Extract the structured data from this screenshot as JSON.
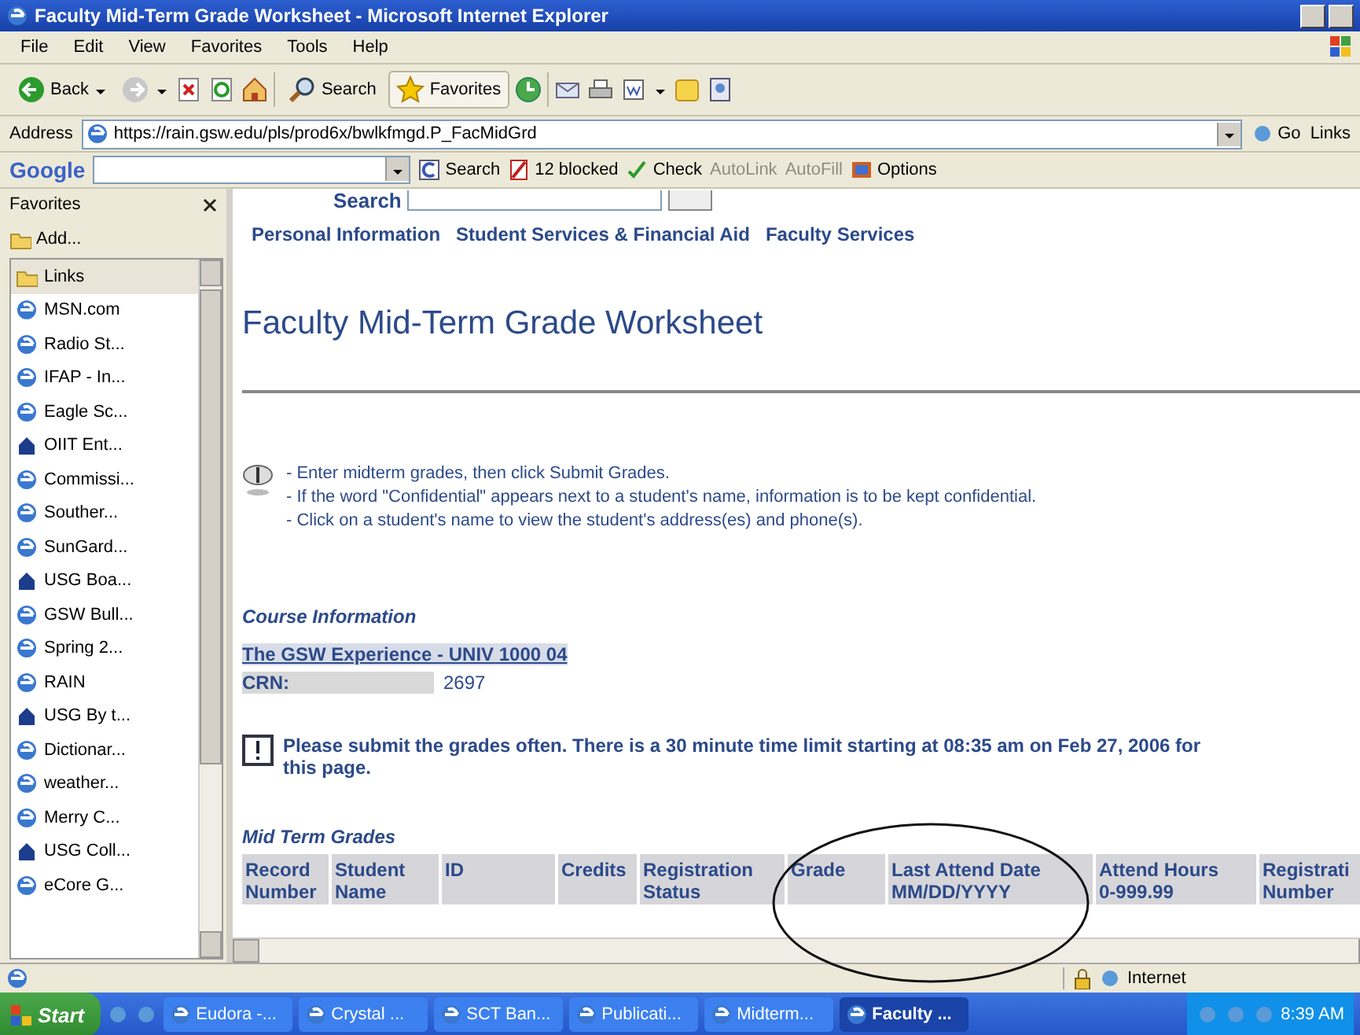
{
  "window": {
    "title": "Faculty Mid-Term Grade Worksheet - Microsoft Internet Explorer"
  },
  "menu": [
    "File",
    "Edit",
    "View",
    "Favorites",
    "Tools",
    "Help"
  ],
  "toolbar": [
    {
      "label": "Back",
      "pressed": false
    },
    {
      "label": "Search",
      "pressed": false
    },
    {
      "label": "Favorites",
      "pressed": true
    }
  ],
  "address": {
    "label": "Address",
    "url": "https://rain.gsw.edu/pls/prod6x/bwlkfmgd.P_FacMidGrd",
    "go": "Go",
    "links": "Links"
  },
  "google_logo": "Google",
  "google_bar": [
    {
      "label": "Search",
      "disabled": false
    },
    {
      "label": "12 blocked",
      "disabled": false
    },
    {
      "label": "Check",
      "disabled": false
    },
    {
      "label": "AutoLink",
      "disabled": true
    },
    {
      "label": "AutoFill",
      "disabled": true
    },
    {
      "label": "Options",
      "disabled": false
    }
  ],
  "favorites": {
    "title": "Favorites",
    "add": "Add...",
    "items": [
      {
        "kind": "folder",
        "label": "Links",
        "selected": true
      },
      {
        "kind": "page",
        "label": "MSN.com",
        "selected": false
      },
      {
        "kind": "page",
        "label": "Radio St...",
        "selected": false
      },
      {
        "kind": "page",
        "label": "IFAP - In...",
        "selected": false
      },
      {
        "kind": "page",
        "label": "Eagle Sc...",
        "selected": false
      },
      {
        "kind": "site",
        "label": "OIIT Ent...",
        "selected": false
      },
      {
        "kind": "page",
        "label": "Commissi...",
        "selected": false
      },
      {
        "kind": "page",
        "label": "Souther...",
        "selected": false
      },
      {
        "kind": "page",
        "label": "SunGard...",
        "selected": false
      },
      {
        "kind": "site",
        "label": "USG Boa...",
        "selected": false
      },
      {
        "kind": "page",
        "label": "GSW Bull...",
        "selected": false
      },
      {
        "kind": "page",
        "label": "Spring 2...",
        "selected": false
      },
      {
        "kind": "page",
        "label": "RAIN",
        "selected": false
      },
      {
        "kind": "site",
        "label": "USG By t...",
        "selected": false
      },
      {
        "kind": "page",
        "label": "Dictionar...",
        "selected": false
      },
      {
        "kind": "page",
        "label": "weather...",
        "selected": false
      },
      {
        "kind": "page",
        "label": "Merry C...",
        "selected": false
      },
      {
        "kind": "site",
        "label": "USG Coll...",
        "selected": false
      },
      {
        "kind": "page",
        "label": "eCore G...",
        "selected": false
      }
    ]
  },
  "page": {
    "search_label": "Search",
    "nav_links": [
      "Personal Information",
      "Student Services & Financial Aid",
      "Faculty Services"
    ],
    "heading": "Faculty Mid-Term Grade Worksheet",
    "instructions": [
      "- Enter midterm grades, then click Submit Grades.",
      "- If the word \"Confidential\" appears next to a student's name, information is to be kept confidential.",
      "- Click on a student's name to view the student's address(es) and phone(s)."
    ],
    "course_heading": "Course Information",
    "course_link": "The GSW Experience - UNIV 1000 04",
    "crn_label": "CRN:",
    "crn_value": "2697",
    "notice": "Please submit the grades often. There is a 30 minute time limit starting at 08:35 am on Feb 27, 2006 for this page.",
    "grades_heading": "Mid Term Grades",
    "table": {
      "columns": [
        [
          "Record",
          "Number"
        ],
        [
          "Student",
          "Name"
        ],
        [
          "ID"
        ],
        [
          "Credits"
        ],
        [
          "Registration",
          "Status"
        ],
        [
          "Grade"
        ],
        [
          "Last Attend Date",
          "MM/DD/YYYY"
        ],
        [
          "Attend Hours",
          "0-999.99"
        ],
        [
          "Registrati",
          "Number"
        ]
      ]
    }
  },
  "status_bar": {
    "zone": "Internet"
  },
  "taskbar": {
    "start": "Start",
    "tasks": [
      {
        "label": "Eudora -...",
        "selected": false
      },
      {
        "label": "Crystal ...",
        "selected": false
      },
      {
        "label": "SCT Ban...",
        "selected": false
      },
      {
        "label": "Publicati...",
        "selected": false
      },
      {
        "label": "Midterm...",
        "selected": false
      },
      {
        "label": "Faculty ...",
        "selected": true
      }
    ],
    "clock": "8:39 AM"
  }
}
